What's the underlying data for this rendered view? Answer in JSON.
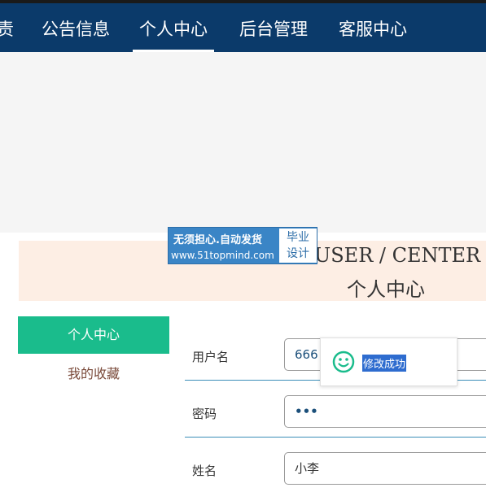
{
  "nav": {
    "items": [
      {
        "label": "责"
      },
      {
        "label": "公告信息"
      },
      {
        "label": "个人中心"
      },
      {
        "label": "后台管理"
      },
      {
        "label": "客服中心"
      }
    ],
    "active_index": 2,
    "bg_color": "#0b3a6a"
  },
  "ad": {
    "line1": "无须担心.自动发货",
    "line2": "www.51topmind.com",
    "box_line1": "毕业",
    "box_line2": "设计"
  },
  "header": {
    "title_en": "USER / CENTER",
    "title_cn": "个人中心"
  },
  "sidebar": {
    "items": [
      {
        "label": "个人中心",
        "active": true
      },
      {
        "label": "我的收藏",
        "active": false
      }
    ],
    "accent_color": "#1abc8c"
  },
  "form": {
    "fields": [
      {
        "label": "用户名",
        "value": "666"
      },
      {
        "label": "密码",
        "value": "•••"
      },
      {
        "label": "姓名",
        "value": "小李"
      }
    ]
  },
  "toast": {
    "icon": "smile-icon",
    "message": "修改成功",
    "icon_color": "#1abc8c"
  }
}
